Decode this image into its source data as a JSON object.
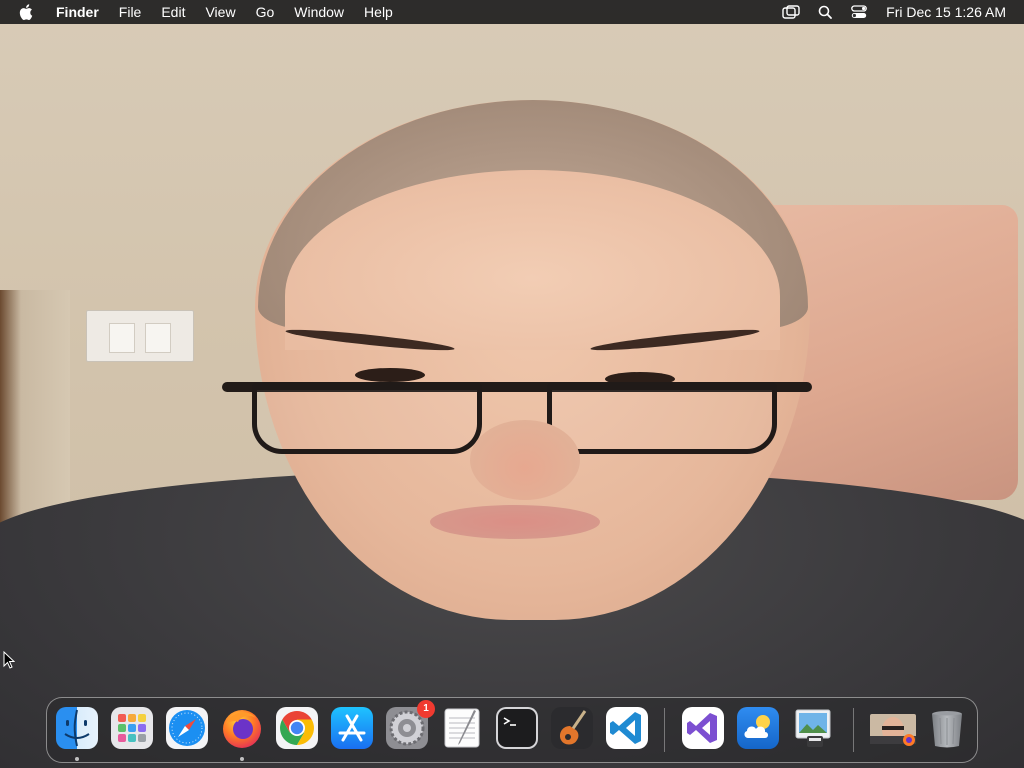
{
  "menubar": {
    "apple_icon": "apple-icon",
    "app_name": "Finder",
    "menus": [
      "File",
      "Edit",
      "View",
      "Go",
      "Window",
      "Help"
    ],
    "status_icons": [
      "screen-mirroring-icon",
      "search-icon",
      "control-center-icon"
    ],
    "clock": "Fri Dec 15  1:26 AM"
  },
  "dock": {
    "apps": [
      {
        "name": "Finder",
        "icon": "finder-icon",
        "running": true
      },
      {
        "name": "Launchpad",
        "icon": "launchpad-icon",
        "running": false
      },
      {
        "name": "Safari",
        "icon": "safari-icon",
        "running": false
      },
      {
        "name": "Firefox",
        "icon": "firefox-icon",
        "running": true
      },
      {
        "name": "Google Chrome",
        "icon": "chrome-icon",
        "running": false
      },
      {
        "name": "App Store",
        "icon": "app-store-icon",
        "running": false
      },
      {
        "name": "System Settings",
        "icon": "system-settings-icon",
        "running": false,
        "badge": "1"
      },
      {
        "name": "TextEdit",
        "icon": "textedit-icon",
        "running": false
      },
      {
        "name": "Terminal",
        "icon": "terminal-icon",
        "running": false
      },
      {
        "name": "GarageBand",
        "icon": "garageband-icon",
        "running": false
      },
      {
        "name": "Visual Studio Code",
        "icon": "vscode-icon",
        "running": false
      }
    ],
    "recent_apps": [
      {
        "name": "Visual Studio",
        "icon": "visual-studio-icon"
      },
      {
        "name": "Weather",
        "icon": "weather-icon"
      },
      {
        "name": "Preview",
        "icon": "preview-icon"
      }
    ],
    "minimized": {
      "name": "Minimized window",
      "icon": "minimized-window-thumbnail"
    },
    "trash": {
      "name": "Trash",
      "icon": "trash-icon"
    }
  },
  "colors": {
    "menubar_bg": "#1e1e1e",
    "badge": "#f03a30",
    "vscode_blue": "#1f8ad2"
  }
}
